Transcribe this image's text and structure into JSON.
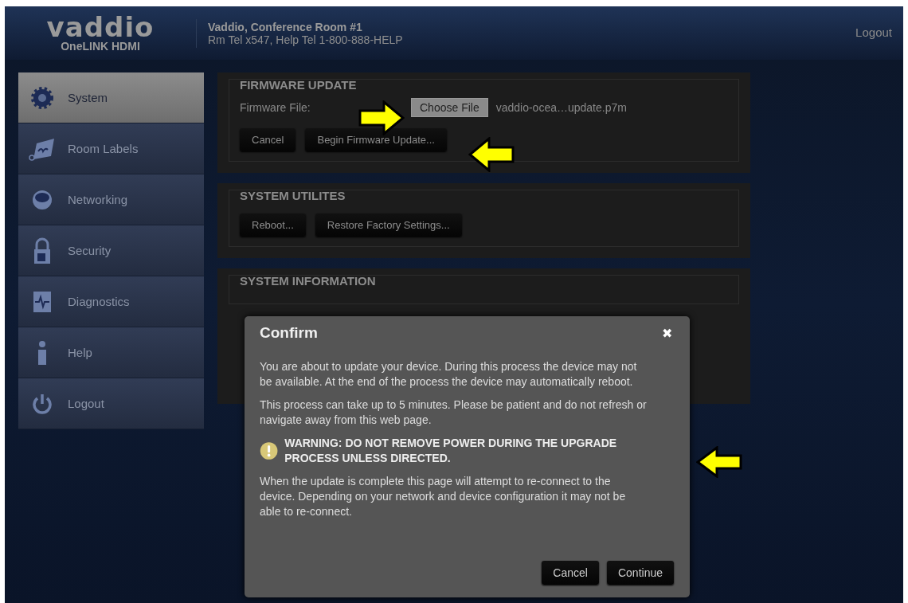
{
  "header": {
    "logo": "vaddio",
    "product": "OneLINK HDMI",
    "room": "Vaddio, Conference Room #1",
    "phones": "Rm Tel x547, Help Tel 1-800-888-HELP",
    "logout": "Logout"
  },
  "sidebar": {
    "items": [
      {
        "label": "System",
        "kind": "gear",
        "selected": true
      },
      {
        "label": "Room Labels",
        "kind": "tag",
        "selected": false
      },
      {
        "label": "Networking",
        "kind": "globe",
        "selected": false
      },
      {
        "label": "Security",
        "kind": "lock",
        "selected": false
      },
      {
        "label": "Diagnostics",
        "kind": "pulse",
        "selected": false
      },
      {
        "label": "Help",
        "kind": "info",
        "selected": false
      },
      {
        "label": "Logout",
        "kind": "power",
        "selected": false
      }
    ]
  },
  "firmware_update": {
    "title": "FIRMWARE UPDATE",
    "file_label": "Firmware File:",
    "choose_button": "Choose File",
    "file_name": "vaddio-ocea…update.p7m",
    "buttons": [
      "Cancel",
      "Begin Firmware Update..."
    ]
  },
  "system_utilities": {
    "title": "SYSTEM UTILITES",
    "buttons": [
      "Reboot...",
      "Restore Factory Settings..."
    ]
  },
  "system_information": {
    "title": "SYSTEM INFORMATION"
  },
  "dialog": {
    "title": "Confirm",
    "close": "✖",
    "paragraphs": [
      "You are about to update your device. During this process the device may not be available. At the end of the process the device may automatically reboot.",
      "This process can take up to 5 minutes. Please be patient and do not refresh or navigate away from this web page."
    ],
    "warning": "WARNING: DO NOT REMOVE POWER DURING THE UPGRADE PROCESS UNLESS DIRECTED.",
    "note": "When the update is complete this page will attempt to re-connect to the device. Depending on your network and device configuration it may not be able to re-connect.",
    "buttons": [
      "Cancel",
      "Continue"
    ]
  }
}
